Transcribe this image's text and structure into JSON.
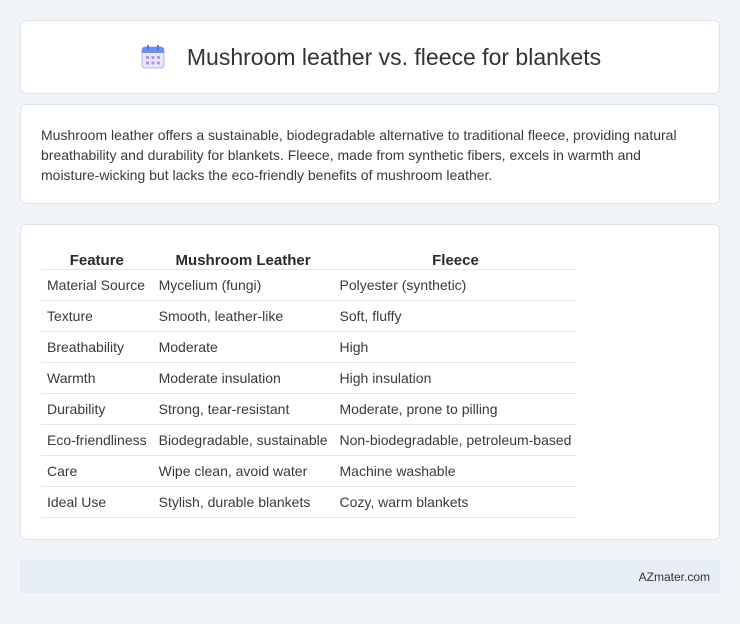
{
  "header": {
    "title": "Mushroom leather vs. fleece for blankets",
    "icon": "calendar-icon"
  },
  "summary": {
    "text": "Mushroom leather offers a sustainable, biodegradable alternative to traditional fleece, providing natural breathability and durability for blankets. Fleece, made from synthetic fibers, excels in warmth and moisture-wicking but lacks the eco-friendly benefits of mushroom leather."
  },
  "table": {
    "headers": [
      "Feature",
      "Mushroom Leather",
      "Fleece"
    ],
    "rows": [
      [
        "Material Source",
        "Mycelium (fungi)",
        "Polyester (synthetic)"
      ],
      [
        "Texture",
        "Smooth, leather-like",
        "Soft, fluffy"
      ],
      [
        "Breathability",
        "Moderate",
        "High"
      ],
      [
        "Warmth",
        "Moderate insulation",
        "High insulation"
      ],
      [
        "Durability",
        "Strong, tear-resistant",
        "Moderate, prone to pilling"
      ],
      [
        "Eco-friendliness",
        "Biodegradable, sustainable",
        "Non-biodegradable, petroleum-based"
      ],
      [
        "Care",
        "Wipe clean, avoid water",
        "Machine washable"
      ],
      [
        "Ideal Use",
        "Stylish, durable blankets",
        "Cozy, warm blankets"
      ]
    ]
  },
  "footer": {
    "brand": "AZmater.com"
  }
}
